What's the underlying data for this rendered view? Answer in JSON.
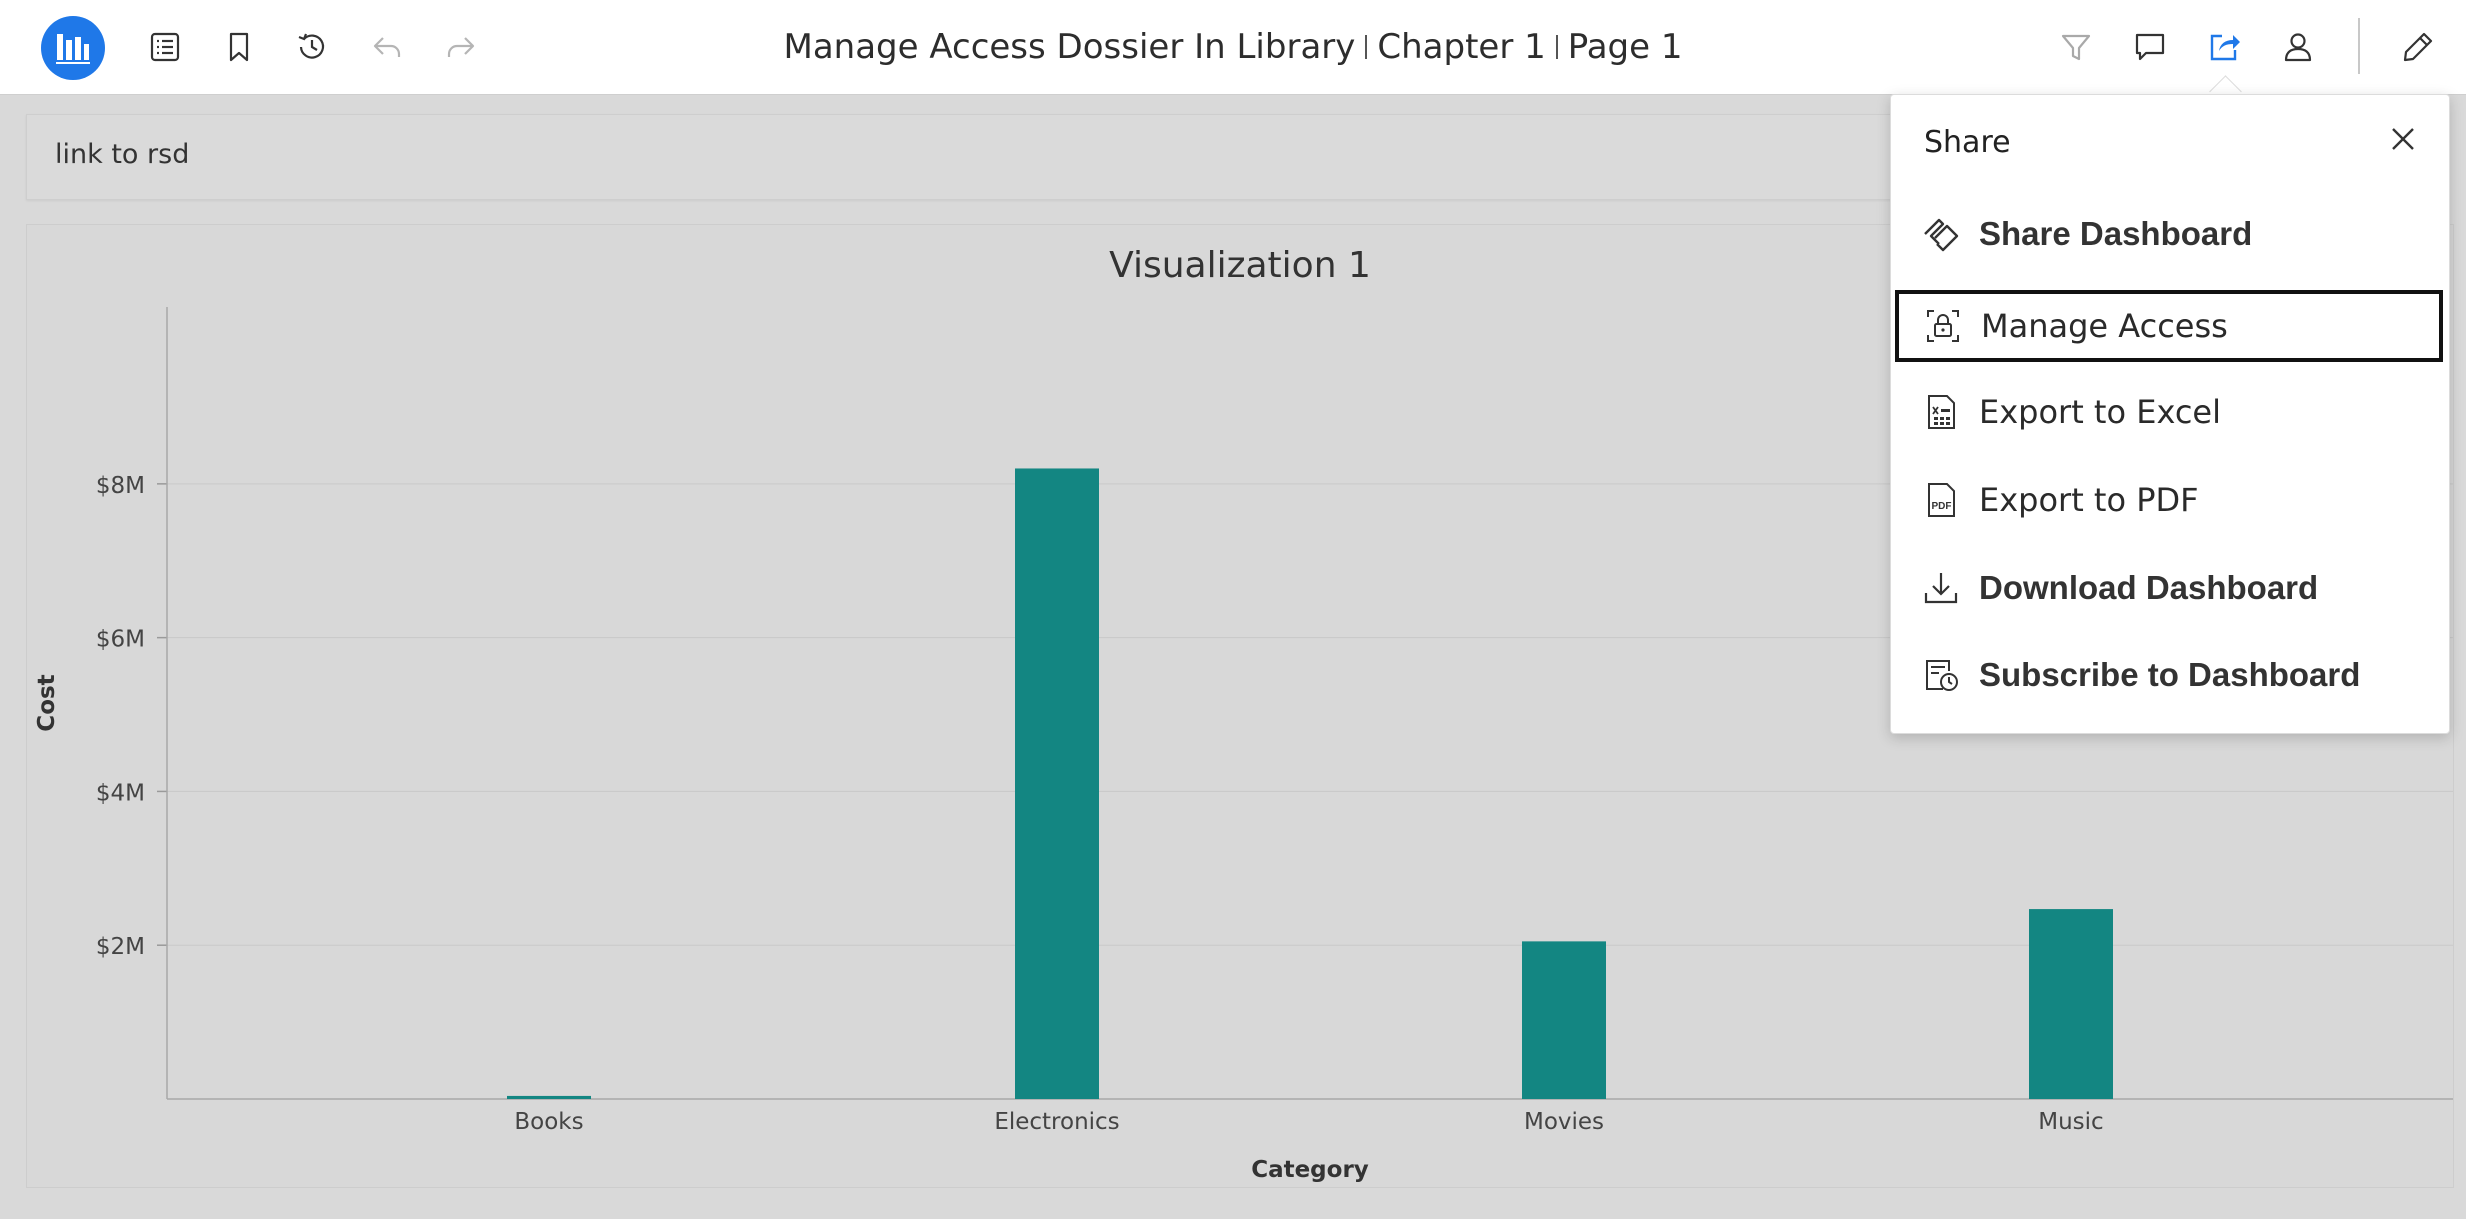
{
  "header": {
    "title": "Manage Access Dossier In Library",
    "chapter": "Chapter 1",
    "page": "Page 1",
    "accent_color": "#1f78e8",
    "left_icons": [
      "library-home-icon",
      "table-of-contents-icon",
      "bookmark-icon",
      "history-icon",
      "undo-icon",
      "redo-icon"
    ],
    "right_icons": [
      "filter-icon",
      "comment-icon",
      "share-icon",
      "account-icon",
      "edit-icon"
    ]
  },
  "link_panel": {
    "text": "link to rsd"
  },
  "share_menu": {
    "title": "Share",
    "items": [
      {
        "label": "Share Dashboard",
        "icon": "share-dashboard-icon"
      },
      {
        "label": "Manage Access",
        "icon": "lock-icon"
      },
      {
        "label": "Export to Excel",
        "icon": "excel-icon"
      },
      {
        "label": "Export to PDF",
        "icon": "pdf-icon"
      },
      {
        "label": "Download Dashboard",
        "icon": "download-icon"
      },
      {
        "label": "Subscribe to Dashboard",
        "icon": "subscribe-icon"
      }
    ]
  },
  "chart_data": {
    "type": "bar",
    "title": "Visualization 1",
    "xlabel": "Category",
    "ylabel": "Cost",
    "categories": [
      "Books",
      "Electronics",
      "Movies",
      "Music"
    ],
    "values": [
      40000,
      8200000,
      2050000,
      2470000
    ],
    "ylim": [
      0,
      10300000
    ],
    "yticks": [
      2000000,
      4000000,
      6000000,
      8000000
    ],
    "ytick_labels": [
      "$2M",
      "$4M",
      "$6M",
      "$8M"
    ],
    "grid": true,
    "bar_color": "#138682"
  }
}
